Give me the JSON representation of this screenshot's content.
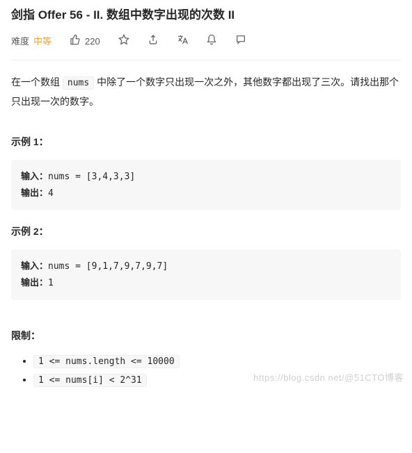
{
  "title": "剑指 Offer 56 - II. 数组中数字出现的次数 II",
  "meta": {
    "difficulty_label": "难度",
    "difficulty_value": "中等",
    "likes": "220"
  },
  "description": {
    "pre": "在一个数组 ",
    "code": "nums",
    "post": " 中除了一个数字只出现一次之外，其他数字都出现了三次。请找出那个只出现一次的数字。"
  },
  "example1": {
    "heading": "示例 1：",
    "input_label": "输入：",
    "input_value": "nums = [3,4,3,3]",
    "output_label": "输出：",
    "output_value": "4"
  },
  "example2": {
    "heading": "示例 2：",
    "input_label": "输入：",
    "input_value": "nums = [9,1,7,9,7,9,7]",
    "output_label": "输出：",
    "output_value": "1"
  },
  "constraints": {
    "heading": "限制：",
    "items": [
      "1 <= nums.length <= 10000",
      "1 <= nums[i] < 2^31"
    ]
  },
  "watermark": "https://blog.csdn.net/@51CTO博客"
}
